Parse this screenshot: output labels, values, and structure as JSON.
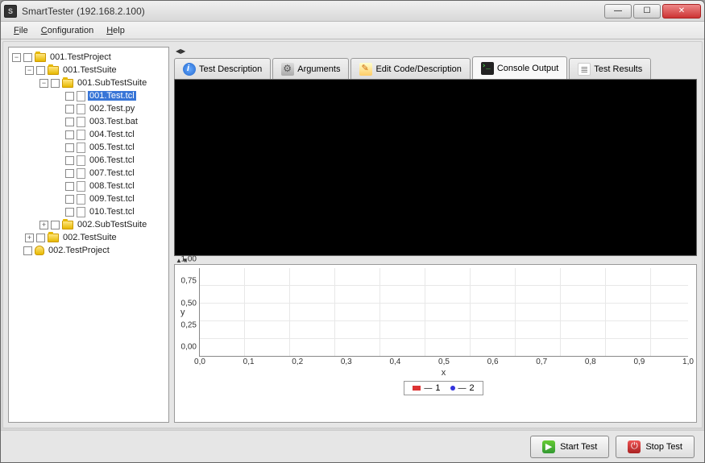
{
  "window": {
    "title": "SmartTester (192.168.2.100)"
  },
  "menu": {
    "file": "File",
    "configuration": "Configuration",
    "help": "Help"
  },
  "tree": {
    "project": "001.TestProject",
    "suite1": "001.TestSuite",
    "subsuite1": "001.SubTestSuite",
    "tests": [
      "001.Test.tcl",
      "002.Test.py",
      "003.Test.bat",
      "004.Test.tcl",
      "005.Test.tcl",
      "006.Test.tcl",
      "007.Test.tcl",
      "008.Test.tcl",
      "009.Test.tcl",
      "010.Test.tcl"
    ],
    "subsuite2": "002.SubTestSuite",
    "suite2": "002.TestSuite",
    "project2": "002.TestProject"
  },
  "tabs": {
    "description": "Test Description",
    "arguments": "Arguments",
    "edit": "Edit Code/Description",
    "console": "Console Output",
    "results": "Test Results"
  },
  "chart_data": {
    "type": "line",
    "title": "",
    "xlabel": "x",
    "ylabel": "y",
    "xlim": [
      0.0,
      1.0
    ],
    "ylim": [
      0.0,
      1.0
    ],
    "x_ticks": [
      "0,0",
      "0,1",
      "0,2",
      "0,3",
      "0,4",
      "0,5",
      "0,6",
      "0,7",
      "0,8",
      "0,9",
      "1,0"
    ],
    "y_ticks": [
      "0,00",
      "0,25",
      "0,50",
      "0,75",
      "1,00"
    ],
    "series": [
      {
        "name": "1",
        "values": []
      },
      {
        "name": "2",
        "values": []
      }
    ]
  },
  "buttons": {
    "start": "Start Test",
    "stop": "Stop Test"
  }
}
